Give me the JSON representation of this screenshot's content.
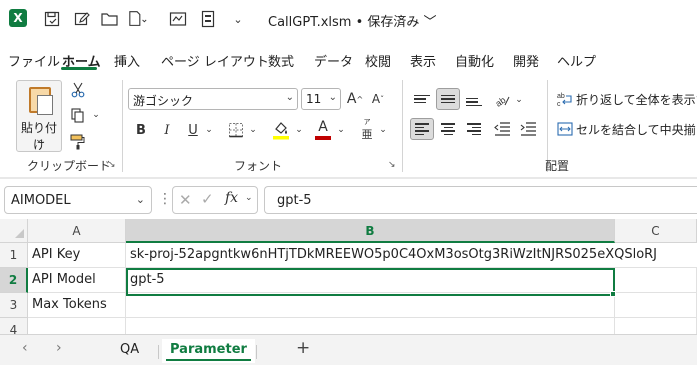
{
  "colors": {
    "accent": "#107c41",
    "excel_logo": "#107c41",
    "font_color_red": "#c00000",
    "highlight_yellow": "#ffff00"
  },
  "titlebar": {
    "app_icon": "excel-logo-icon",
    "title": "CallGPT.xlsm • 保存済み ﹀",
    "quick_access_icons": [
      "autosave-icon",
      "edit-icon",
      "open-folder-icon",
      "new-file-icon",
      "print-icon",
      "form-icon",
      "more-icon"
    ]
  },
  "menu": {
    "tabs": [
      "ファイル",
      "ホーム",
      "挿入",
      "ページ レイアウト",
      "数式",
      "データ",
      "校閲",
      "表示",
      "自動化",
      "開発",
      "ヘルプ"
    ],
    "active": "ホーム"
  },
  "ribbon": {
    "clipboard": {
      "paste_label": "貼り付け",
      "paste_caret": "⌄",
      "group_label": "クリップボード"
    },
    "font": {
      "font_name": "游ゴシック",
      "font_size": "11",
      "grow": "A",
      "shrink": "A",
      "bold": "B",
      "italic": "I",
      "underline": "U",
      "font_color_letter": "A",
      "phonetic_glyph": "亜",
      "group_label": "フォント"
    },
    "alignment": {
      "wrap_text": "折り返して全体を表示する",
      "merge_center": "セルを結合して中央揃え",
      "group_label": "配置",
      "orientation_glyph": "ab"
    }
  },
  "formula_bar": {
    "name_box": "AIMODEL",
    "fx": "fx",
    "value": "gpt-5"
  },
  "grid": {
    "columns": [
      "A",
      "B",
      "C"
    ],
    "selected_column": "B",
    "selected_row": "2",
    "rows": [
      {
        "num": "1",
        "a": "API Key",
        "b": "sk-proj-52apgntkw6nHTjTDkMREEWO5p0C4OxM3osOtg3RiWzItNJRS025eXQSloRJ"
      },
      {
        "num": "2",
        "a": "API Model",
        "b": "gpt-5"
      },
      {
        "num": "3",
        "a": "Max Tokens",
        "b": ""
      },
      {
        "num": "4",
        "a": "",
        "b": ""
      }
    ]
  },
  "sheets": {
    "tabs": [
      "QA",
      "Parameter"
    ],
    "active": "Parameter",
    "add": "+"
  }
}
